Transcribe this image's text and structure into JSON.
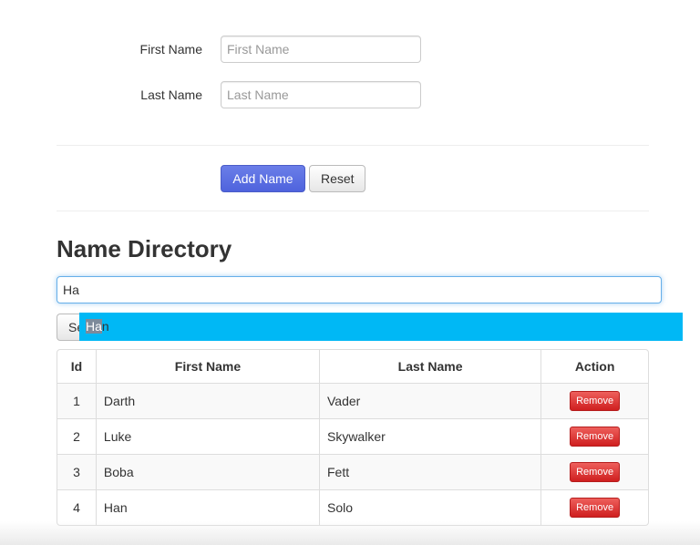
{
  "form": {
    "first_name_label": "First Name",
    "first_name_placeholder": "First Name",
    "first_name_value": "",
    "last_name_label": "Last Name",
    "last_name_placeholder": "Last Name",
    "last_name_value": "",
    "add_button": "Add Name",
    "reset_button": "Reset"
  },
  "directory": {
    "title": "Name Directory",
    "search_value": "Ha",
    "search_button_visible_prefix": "Se",
    "autocomplete": {
      "match": "Ha",
      "rest": "n"
    },
    "columns": [
      "Id",
      "First Name",
      "Last Name",
      "Action"
    ],
    "rows": [
      {
        "id": "1",
        "first": "Darth",
        "last": "Vader",
        "action": "Remove"
      },
      {
        "id": "2",
        "first": "Luke",
        "last": "Skywalker",
        "action": "Remove"
      },
      {
        "id": "3",
        "first": "Boba",
        "last": "Fett",
        "action": "Remove"
      },
      {
        "id": "4",
        "first": "Han",
        "last": "Solo",
        "action": "Remove"
      }
    ]
  },
  "colors": {
    "primary": "#5b6fe0",
    "danger": "#d62828",
    "autocomplete": "#00b8f5",
    "focus": "#66afe9"
  }
}
